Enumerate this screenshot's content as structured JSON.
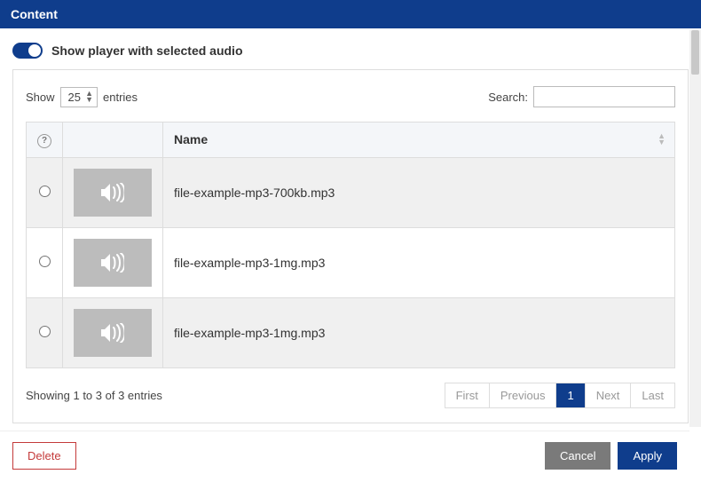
{
  "header": {
    "title": "Content"
  },
  "toggle": {
    "label": "Show player with selected audio"
  },
  "entriesControl": {
    "prefix": "Show",
    "value": "25",
    "suffix": "entries"
  },
  "search": {
    "label": "Search:",
    "value": ""
  },
  "columns": {
    "name": "Name"
  },
  "rows": [
    {
      "name": "file-example-mp3-700kb.mp3"
    },
    {
      "name": "file-example-mp3-1mg.mp3"
    },
    {
      "name": "file-example-mp3-1mg.mp3"
    }
  ],
  "info": "Showing 1 to 3 of 3 entries",
  "pagination": {
    "first": "First",
    "previous": "Previous",
    "page": "1",
    "next": "Next",
    "last": "Last"
  },
  "buttons": {
    "delete": "Delete",
    "cancel": "Cancel",
    "apply": "Apply"
  }
}
